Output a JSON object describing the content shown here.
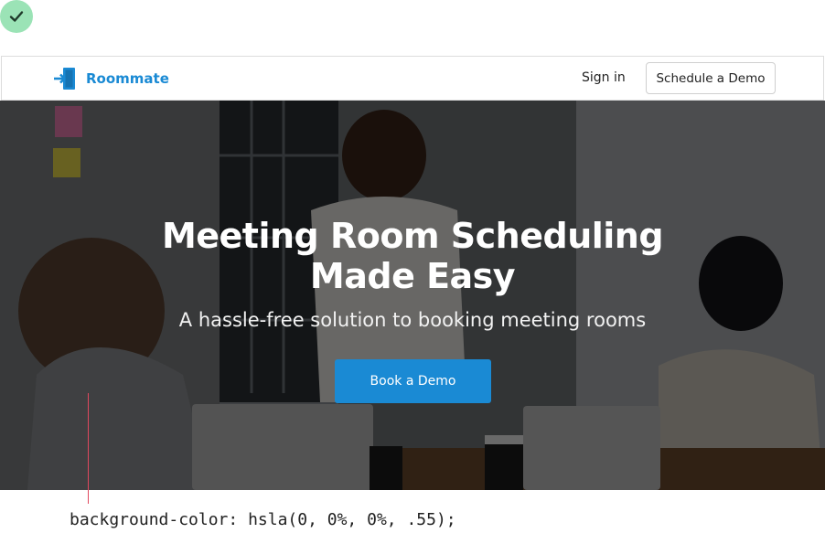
{
  "status": {
    "icon": "check-icon",
    "color": "#9be3b6"
  },
  "navbar": {
    "brand_name": "Roommate",
    "brand_icon": "door-enter-icon",
    "brand_color": "#1a8ad4",
    "signin_label": "Sign in",
    "demo_label": "Schedule a Demo"
  },
  "hero": {
    "title_line1": "Meeting Room Scheduling",
    "title_line2": "Made Easy",
    "subtitle": "A hassle-free solution to booking meeting rooms",
    "cta_label": "Book a Demo",
    "overlay_color": "hsla(0, 0%, 0%, .55)"
  },
  "caption": {
    "code": "background-color: hsla(0, 0%, 0%, .55);",
    "marker_color": "#e0485e"
  }
}
